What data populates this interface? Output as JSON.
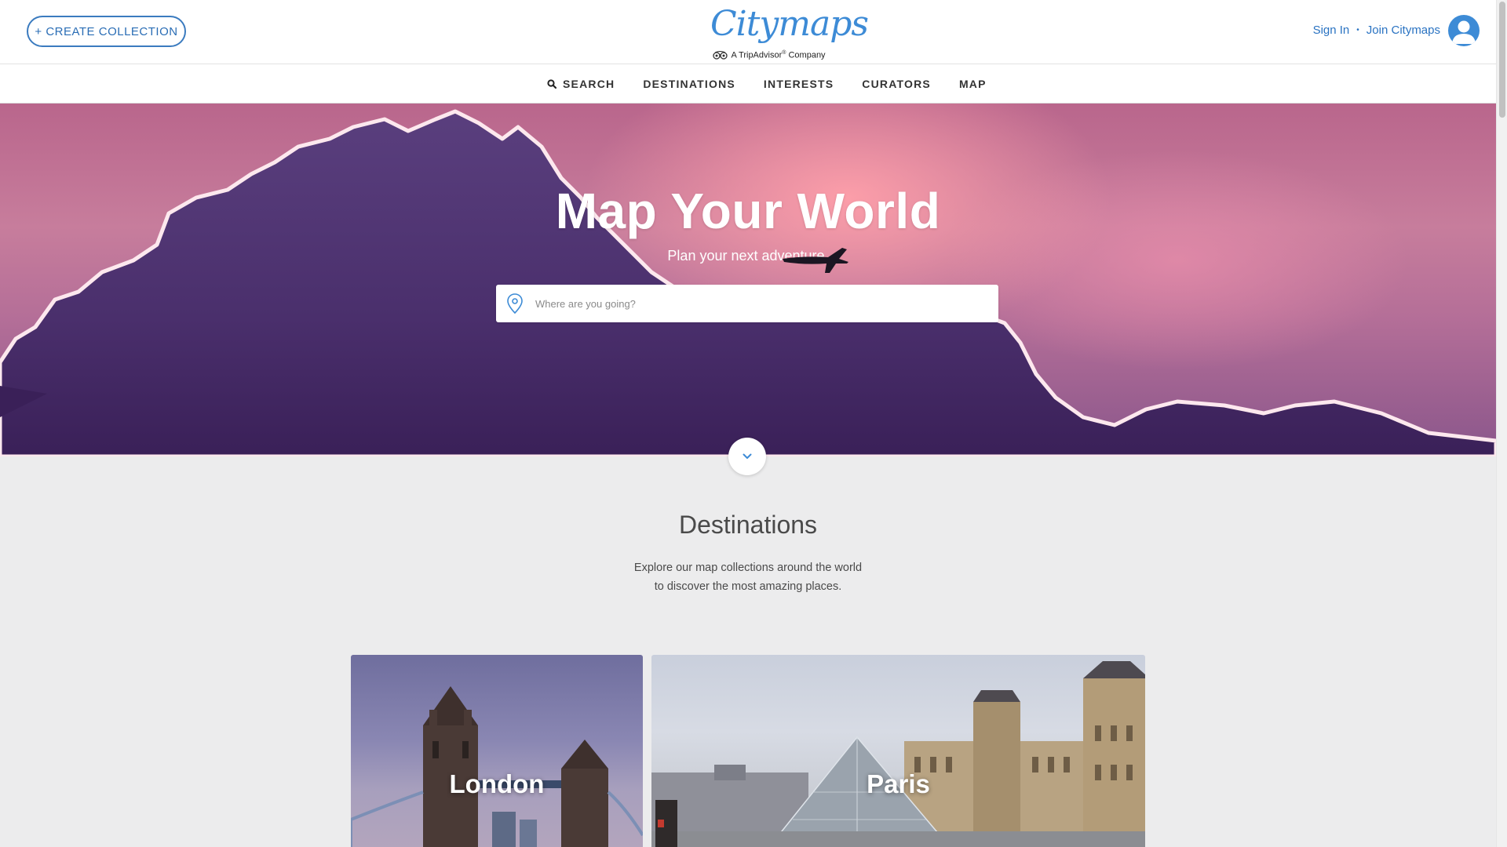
{
  "header": {
    "create_collection_label": "+ CREATE COLLECTION",
    "logo_text": "Citymaps",
    "logo_tagline_prefix": "A TripAdvisor",
    "logo_tagline_reg": "®",
    "logo_tagline_suffix": " Company",
    "sign_in_label": "Sign In",
    "separator": "•",
    "join_label": "Join Citymaps",
    "brand_color": "#3d8bd6"
  },
  "nav": {
    "items": [
      {
        "label": "SEARCH",
        "icon": "search-icon"
      },
      {
        "label": "DESTINATIONS"
      },
      {
        "label": "INTERESTS"
      },
      {
        "label": "CURATORS"
      },
      {
        "label": "MAP"
      }
    ]
  },
  "hero": {
    "title": "Map Your World",
    "subtitle": "Plan your next adventure.",
    "search_placeholder": "Where are you going?",
    "search_value": ""
  },
  "destinations": {
    "title": "Destinations",
    "description_line1": "Explore our map collections around the world",
    "description_line2": "to discover the most amazing places.",
    "cards": [
      {
        "label": "London"
      },
      {
        "label": "Paris"
      }
    ]
  }
}
